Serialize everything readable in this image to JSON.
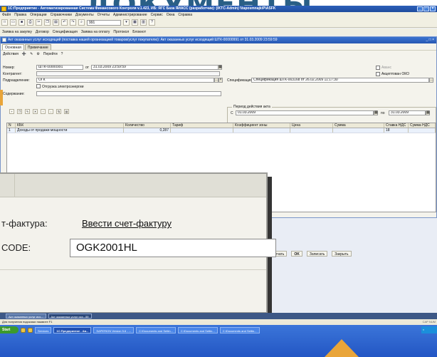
{
  "app": {
    "title": "1С:Предприятие - Автоматизированная Система Финансового Контроля v.1.423, ИБ: ЯГС База ЯИАСС (разработчик): (IKTC-Admin) \\\\taposmnajk\\P\\ASFK",
    "menu": [
      "Файл",
      "Правка",
      "Операции",
      "Справочники",
      "Документы",
      "Отчеты",
      "Администрирование",
      "Сервис",
      "Окна",
      "Справка"
    ],
    "toolbar_input": "991",
    "toolbar2": [
      "Заявка на закупку",
      "Договор",
      "Спецификация",
      "Заявка на оплату",
      "Протокол",
      "Блокнот"
    ]
  },
  "doc": {
    "title": "Акт оказанных услуг исходящий (поставка нашей организацией товаров/услуг покупателю): Акт оказанных услуг исходящий ШТК-00000991 от 31.03.2009 23:59:59",
    "tabs": [
      "Основная",
      "Примечание"
    ],
    "actions": [
      "Действия",
      "Перейти",
      "?"
    ],
    "fields": {
      "number_label": "Номер:",
      "number_value": "ШТК-00000991",
      "date_label": "от",
      "date_value": "31.03.2009 23:59:59",
      "contractor_label": "Контрагент:",
      "division_label": "Подразделение:",
      "division_value": "ОГК",
      "spec_label": "Спецификация:",
      "spec_value": "Спецификация ШТК-003168 от 26.02.2009 11:17:30",
      "electricity_label": "Отгрузка электроэнергии",
      "content_label": "Содержание:",
      "advance_label": "Аванс",
      "okd_label": "Акцептован ОКО"
    },
    "period": {
      "title": "Период действия акта",
      "from_label": "С",
      "from_value": "01.03.2009",
      "to_label": "по",
      "to_value": "31.03.2009"
    },
    "grid": {
      "columns": [
        "N",
        "КБК",
        "Количество",
        "Тариф",
        "Коэффициент зоны",
        "Цена",
        "Сумма",
        "Ставка НДС",
        "Сумма НДС"
      ],
      "rows": [
        [
          "1",
          "Доходы от продажи мощности",
          "0,287",
          "",
          "",
          "",
          "",
          "18",
          ""
        ]
      ]
    },
    "footer": {
      "print_label": "Печать",
      "ok_label": "OK",
      "save_label": "Записать",
      "close_label": "Закрыть"
    }
  },
  "zoom": {
    "invoice_label": "т-фактура:",
    "invoice_link": "Ввести счет-фактуру",
    "code_label": "CODE:",
    "code_value": "OGK2001HL"
  },
  "mdi_tabs": [
    "Акт оказанных услуг исх...",
    "Акт оказанных услуг исх...59"
  ],
  "status_text": "Для получения подсказки нажмите F1",
  "status_right": "CAP NUM",
  "taskbar": {
    "start": "Start",
    "buttons": [
      "Services",
      "1С:Предприятие - Ав...",
      "SAPERION Version 5.6 - ...",
      "C:\\Documents and Settin...",
      "C:\\Documents and Settin...",
      "C:\\Documents and Settin..."
    ],
    "active_index": 1
  },
  "colors": {
    "title_blue": "#2c5fb8",
    "taskbar_blue": "#2356c4",
    "accent_orange": "#e9a53a"
  }
}
